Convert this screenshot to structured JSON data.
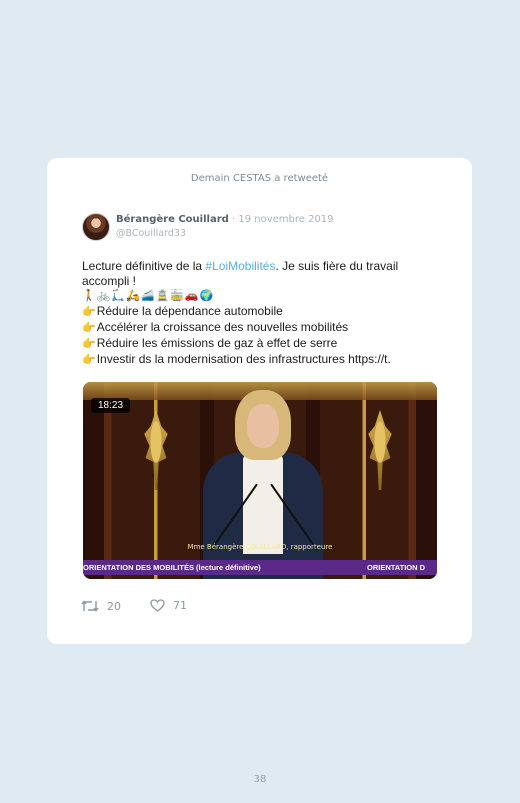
{
  "retweet_notice": "Demain CESTAS a retweeté",
  "tweet": {
    "author_name": "Bérangère Couillard",
    "separator": " · ",
    "date": "19 novembre 2019",
    "handle": "@BCouillard33",
    "text_before_hashtag": "Lecture définitive de la ",
    "hashtag": "#LoiMobilités",
    "text_after_hashtag": ". Je suis fière du travail",
    "text_line2": "accompli !",
    "emoji_row": "🚶🚲🛴🛵🚄🚊🚋🚗🌍",
    "bullet_icon": "👉",
    "points": [
      "Réduire la dépendance automobile",
      "Accélérer la croissance des nouvelles mobilités",
      "Réduire les émissions de gaz à effet de serre",
      "Investir ds la modernisation des infrastructures https://t."
    ]
  },
  "video": {
    "timestamp": "18:23",
    "speaker_caption": "Mme Bérangère COUILLARD, rapporteure",
    "banner_left": "ORIENTATION DES MOBILITÉS (lecture définitive)",
    "banner_right": "ORIENTATION D"
  },
  "actions": {
    "retweet_icon": "retweet-icon",
    "retweet_count": "20",
    "like_icon": "heart-icon",
    "like_count": "71"
  },
  "page_number": "38"
}
